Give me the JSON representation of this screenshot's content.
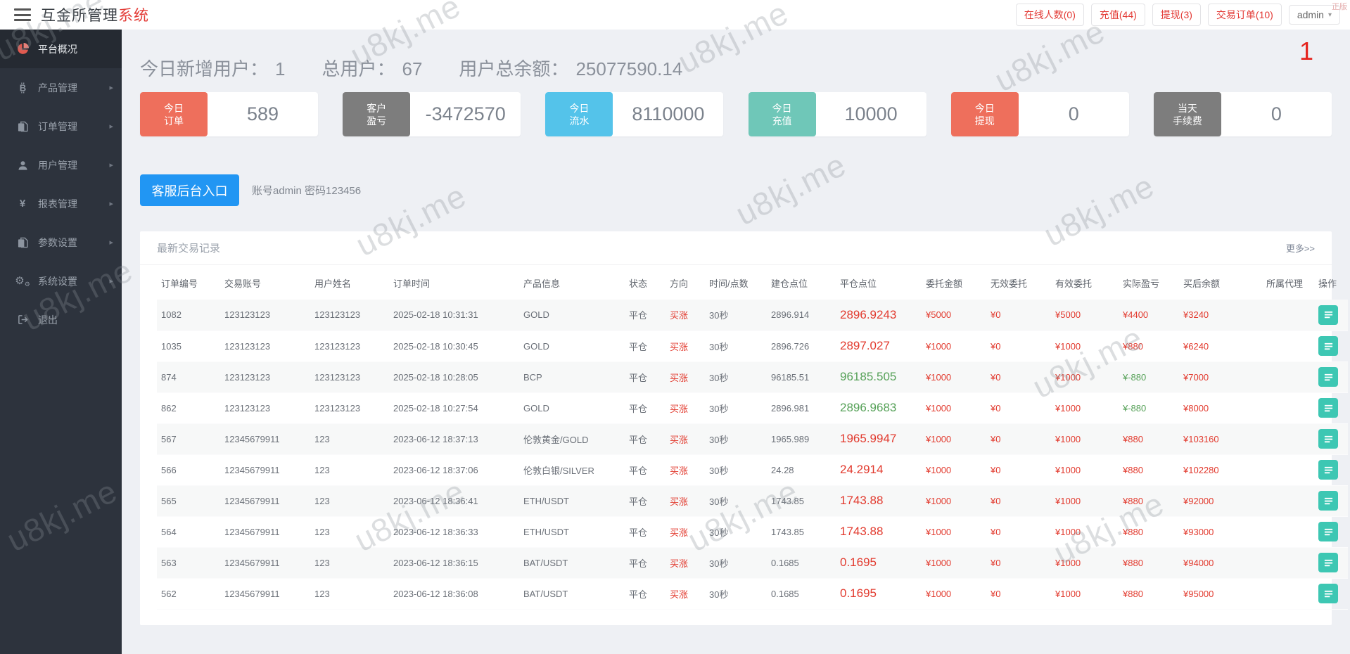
{
  "header": {
    "brand_main": "互金所管理",
    "brand_accent": "系统",
    "links": [
      {
        "label": "在线人数(0)"
      },
      {
        "label": "充值(44)"
      },
      {
        "label": "提现(3)"
      },
      {
        "label": "交易订单(10)"
      }
    ],
    "user": {
      "label": "admin"
    }
  },
  "corner_text": "正版",
  "page_marker": "1",
  "watermark": {
    "text": "u8kj.me"
  },
  "sidebar": {
    "items": [
      {
        "label": "平台概况",
        "icon": "pie-chart-icon",
        "active": true,
        "has_arrow": false
      },
      {
        "label": "产品管理",
        "icon": "bitcoin-icon",
        "active": false,
        "has_arrow": true
      },
      {
        "label": "订单管理",
        "icon": "copy-icon",
        "active": false,
        "has_arrow": true
      },
      {
        "label": "用户管理",
        "icon": "user-icon",
        "active": false,
        "has_arrow": true
      },
      {
        "label": "报表管理",
        "icon": "yen-icon",
        "active": false,
        "has_arrow": true
      },
      {
        "label": "参数设置",
        "icon": "file-icon",
        "active": false,
        "has_arrow": true
      },
      {
        "label": "系统设置",
        "icon": "gears-icon",
        "active": false,
        "has_arrow": true
      },
      {
        "label": "退出",
        "icon": "logout-icon",
        "active": false,
        "has_arrow": false
      }
    ]
  },
  "overview": {
    "stats": [
      {
        "label": "今日新增用户：",
        "value": "1"
      },
      {
        "label": "总用户：",
        "value": "67"
      },
      {
        "label": "用户总余额：",
        "value": "25077590.14"
      }
    ]
  },
  "cards": [
    {
      "name": "today-orders",
      "label_lines": [
        "今日",
        "订单"
      ],
      "value": "589",
      "color": "#ee6f5c"
    },
    {
      "name": "customer-pnl",
      "label_lines": [
        "客户",
        "盈亏"
      ],
      "value": "-3472570",
      "color": "#7d7d7d"
    },
    {
      "name": "today-turnover",
      "label_lines": [
        "今日",
        "流水"
      ],
      "value": "8110000",
      "color": "#54c3ea"
    },
    {
      "name": "today-deposit",
      "label_lines": [
        "今日",
        "充值"
      ],
      "value": "10000",
      "color": "#6fc7b8"
    },
    {
      "name": "today-withdraw",
      "label_lines": [
        "今日",
        "提现"
      ],
      "value": "0",
      "color": "#ee6f5c"
    },
    {
      "name": "today-fee",
      "label_lines": [
        "当天",
        "手续费"
      ],
      "value": "0",
      "color": "#7d7d7d"
    }
  ],
  "service_entry": {
    "button_label": "客服后台入口",
    "note": "账号admin 密码123456"
  },
  "panel": {
    "title": "最新交易记录",
    "more_label": "更多>>"
  },
  "table": {
    "columns": [
      {
        "key": "id",
        "label": "订单编号"
      },
      {
        "key": "account",
        "label": "交易账号"
      },
      {
        "key": "name",
        "label": "用户姓名"
      },
      {
        "key": "time",
        "label": "订单时间"
      },
      {
        "key": "product",
        "label": "产品信息"
      },
      {
        "key": "status",
        "label": "状态"
      },
      {
        "key": "direction",
        "label": "方向"
      },
      {
        "key": "duration",
        "label": "时间/点数"
      },
      {
        "key": "open",
        "label": "建仓点位"
      },
      {
        "key": "close",
        "label": "平仓点位"
      },
      {
        "key": "amount",
        "label": "委托金额"
      },
      {
        "key": "invalid",
        "label": "无效委托"
      },
      {
        "key": "valid",
        "label": "有效委托"
      },
      {
        "key": "profit",
        "label": "实际盈亏"
      },
      {
        "key": "balance",
        "label": "买后余额"
      },
      {
        "key": "agent",
        "label": "所属代理"
      },
      {
        "key": "action",
        "label": "操作"
      }
    ],
    "rows": [
      {
        "id": "1082",
        "account": "123123123",
        "name": "123123123",
        "time": "2025-02-18 10:31:31",
        "product": "GOLD",
        "status": "平仓",
        "direction": "买涨",
        "duration": "30秒",
        "open": "2896.914",
        "close": "2896.9243",
        "close_color": "red",
        "amount": "¥5000",
        "invalid": "¥0",
        "valid": "¥5000",
        "profit": "¥4400",
        "profit_color": "red",
        "balance": "¥3240",
        "agent": ""
      },
      {
        "id": "1035",
        "account": "123123123",
        "name": "123123123",
        "time": "2025-02-18 10:30:45",
        "product": "GOLD",
        "status": "平仓",
        "direction": "买涨",
        "duration": "30秒",
        "open": "2896.726",
        "close": "2897.027",
        "close_color": "red",
        "amount": "¥1000",
        "invalid": "¥0",
        "valid": "¥1000",
        "profit": "¥880",
        "profit_color": "red",
        "balance": "¥6240",
        "agent": ""
      },
      {
        "id": "874",
        "account": "123123123",
        "name": "123123123",
        "time": "2025-02-18 10:28:05",
        "product": "BCP",
        "status": "平仓",
        "direction": "买涨",
        "duration": "30秒",
        "open": "96185.51",
        "close": "96185.505",
        "close_color": "green",
        "amount": "¥1000",
        "invalid": "¥0",
        "valid": "¥1000",
        "profit": "¥-880",
        "profit_color": "green",
        "balance": "¥7000",
        "agent": ""
      },
      {
        "id": "862",
        "account": "123123123",
        "name": "123123123",
        "time": "2025-02-18 10:27:54",
        "product": "GOLD",
        "status": "平仓",
        "direction": "买涨",
        "duration": "30秒",
        "open": "2896.981",
        "close": "2896.9683",
        "close_color": "green",
        "amount": "¥1000",
        "invalid": "¥0",
        "valid": "¥1000",
        "profit": "¥-880",
        "profit_color": "green",
        "balance": "¥8000",
        "agent": ""
      },
      {
        "id": "567",
        "account": "12345679911",
        "name": "123",
        "time": "2023-06-12 18:37:13",
        "product": "伦敦黄金/GOLD",
        "status": "平仓",
        "direction": "买涨",
        "duration": "30秒",
        "open": "1965.989",
        "close": "1965.9947",
        "close_color": "red",
        "amount": "¥1000",
        "invalid": "¥0",
        "valid": "¥1000",
        "profit": "¥880",
        "profit_color": "red",
        "balance": "¥103160",
        "agent": ""
      },
      {
        "id": "566",
        "account": "12345679911",
        "name": "123",
        "time": "2023-06-12 18:37:06",
        "product": "伦敦白银/SILVER",
        "status": "平仓",
        "direction": "买涨",
        "duration": "30秒",
        "open": "24.28",
        "close": "24.2914",
        "close_color": "red",
        "amount": "¥1000",
        "invalid": "¥0",
        "valid": "¥1000",
        "profit": "¥880",
        "profit_color": "red",
        "balance": "¥102280",
        "agent": ""
      },
      {
        "id": "565",
        "account": "12345679911",
        "name": "123",
        "time": "2023-06-12 18:36:41",
        "product": "ETH/USDT",
        "status": "平仓",
        "direction": "买涨",
        "duration": "30秒",
        "open": "1743.85",
        "close": "1743.88",
        "close_color": "red",
        "amount": "¥1000",
        "invalid": "¥0",
        "valid": "¥1000",
        "profit": "¥880",
        "profit_color": "red",
        "balance": "¥92000",
        "agent": ""
      },
      {
        "id": "564",
        "account": "12345679911",
        "name": "123",
        "time": "2023-06-12 18:36:33",
        "product": "ETH/USDT",
        "status": "平仓",
        "direction": "买涨",
        "duration": "30秒",
        "open": "1743.85",
        "close": "1743.88",
        "close_color": "red",
        "amount": "¥1000",
        "invalid": "¥0",
        "valid": "¥1000",
        "profit": "¥880",
        "profit_color": "red",
        "balance": "¥93000",
        "agent": ""
      },
      {
        "id": "563",
        "account": "12345679911",
        "name": "123",
        "time": "2023-06-12 18:36:15",
        "product": "BAT/USDT",
        "status": "平仓",
        "direction": "买涨",
        "duration": "30秒",
        "open": "0.1685",
        "close": "0.1695",
        "close_color": "red",
        "amount": "¥1000",
        "invalid": "¥0",
        "valid": "¥1000",
        "profit": "¥880",
        "profit_color": "red",
        "balance": "¥94000",
        "agent": ""
      },
      {
        "id": "562",
        "account": "12345679911",
        "name": "123",
        "time": "2023-06-12 18:36:08",
        "product": "BAT/USDT",
        "status": "平仓",
        "direction": "买涨",
        "duration": "30秒",
        "open": "0.1685",
        "close": "0.1695",
        "close_color": "red",
        "amount": "¥1000",
        "invalid": "¥0",
        "valid": "¥1000",
        "profit": "¥880",
        "profit_color": "red",
        "balance": "¥95000",
        "agent": ""
      }
    ]
  }
}
